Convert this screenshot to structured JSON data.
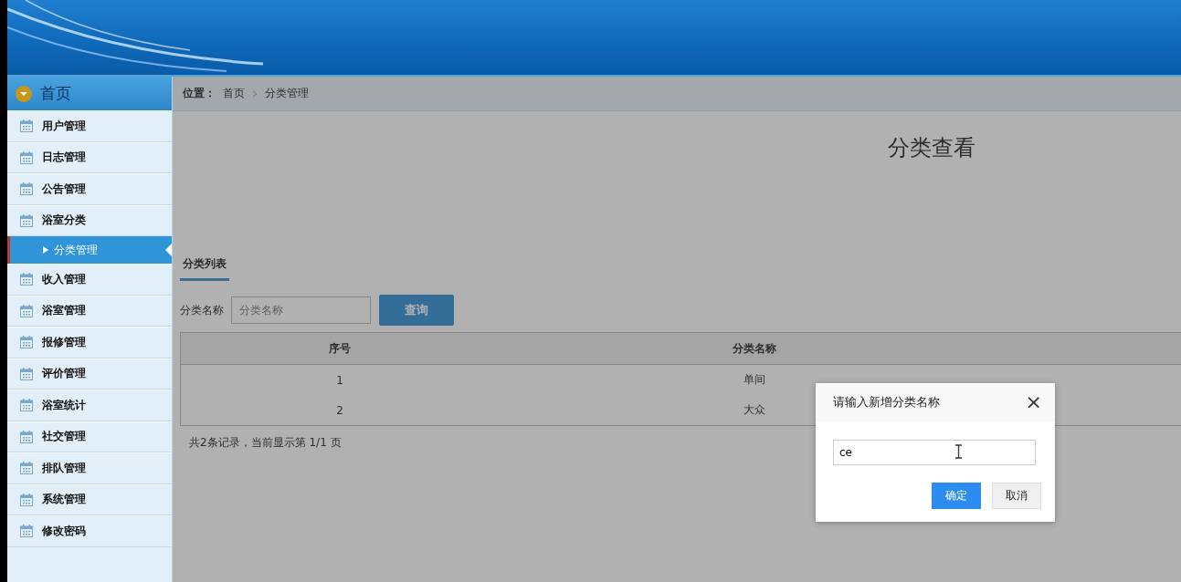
{
  "sidebar": {
    "home": {
      "label": "首页"
    },
    "items": [
      {
        "label": "用户管理"
      },
      {
        "label": "日志管理"
      },
      {
        "label": "公告管理"
      },
      {
        "label": "浴室分类",
        "children": [
          {
            "label": "分类管理",
            "selected": true
          }
        ]
      },
      {
        "label": "收入管理"
      },
      {
        "label": "浴室管理"
      },
      {
        "label": "报修管理"
      },
      {
        "label": "评价管理"
      },
      {
        "label": "浴室统计"
      },
      {
        "label": "社交管理"
      },
      {
        "label": "排队管理"
      },
      {
        "label": "系统管理"
      },
      {
        "label": "修改密码"
      }
    ]
  },
  "breadcrumb": {
    "label": "位置：",
    "items": [
      "首页",
      "分类管理"
    ]
  },
  "page_title": "分类查看",
  "tab": {
    "label": "分类列表",
    "selected": true
  },
  "search": {
    "label": "分类名称",
    "placeholder": "分类名称",
    "button": "查询"
  },
  "table": {
    "columns": [
      "序号",
      "分类名称"
    ],
    "rows": [
      [
        "1",
        "单间"
      ],
      [
        "2",
        "大众"
      ]
    ]
  },
  "pagination": "共2条记录，当前显示第 1/1 页",
  "dialog": {
    "title": "请输入新增分类名称",
    "close": "×",
    "value": "ce",
    "buttons": [
      {
        "label": "确定",
        "kind": "primary"
      },
      {
        "label": "取消",
        "kind": "default"
      }
    ]
  }
}
